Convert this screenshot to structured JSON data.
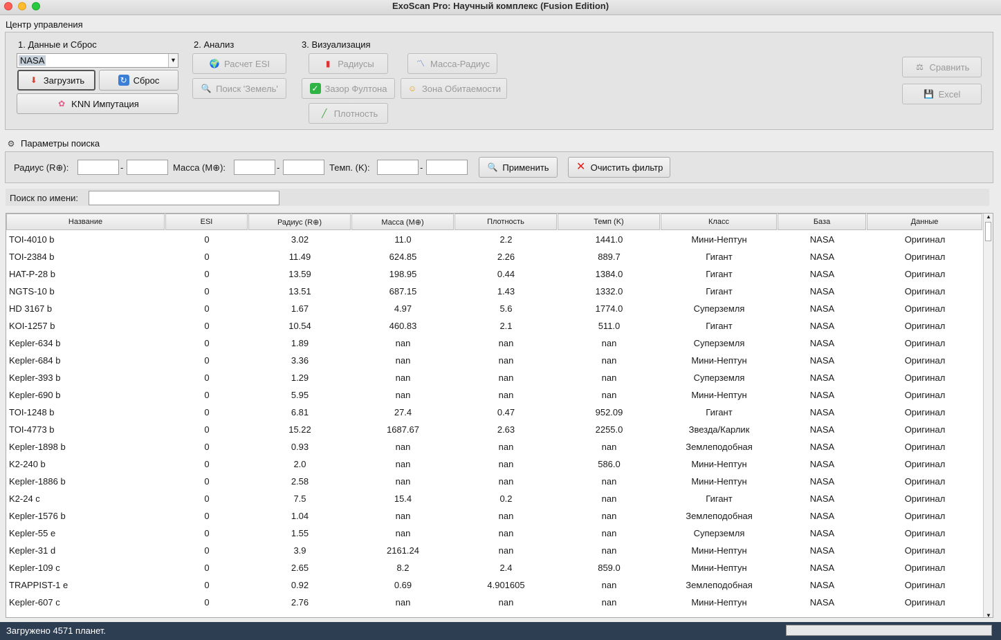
{
  "window": {
    "title": "ExoScan Pro: Научный комплекс (Fusion Edition)"
  },
  "control_center": {
    "title": "Центр управления",
    "data_reset": {
      "heading": "1. Данные и Сброс",
      "source_value": "NASA",
      "load_label": "Загрузить",
      "reset_label": "Сброс",
      "knn_label": "KNN Импутация"
    },
    "analysis": {
      "heading": "2. Анализ",
      "esi_label": "Расчет ESI",
      "earth_search_label": "Поиск 'Земель'"
    },
    "visualization": {
      "heading": "3. Визуализация",
      "radii_label": "Радиусы",
      "mass_radius_label": "Масса-Радиус",
      "fulton_gap_label": "Зазор Фултона",
      "habitable_zone_label": "Зона Обитаемости",
      "density_label": "Плотность"
    },
    "compare_label": "Сравнить",
    "excel_label": "Excel"
  },
  "search_params": {
    "title": "Параметры поиска",
    "radius_label": "Радиус (R⊕):",
    "mass_label": "Масса (M⊕):",
    "temp_label": "Темп. (K):",
    "dash": "-",
    "apply_label": "Применить",
    "clear_label": "Очистить фильтр"
  },
  "name_search": {
    "label": "Поиск по имени:",
    "value": ""
  },
  "table": {
    "columns": [
      "Название",
      "ESI",
      "Радиус (R⊕)",
      "Масса (M⊕)",
      "Плотность",
      "Темп (K)",
      "Класс",
      "База",
      "Данные"
    ],
    "rows": [
      [
        "TOI-4010 b",
        "0",
        "3.02",
        "11.0",
        "2.2",
        "1441.0",
        "Мини-Нептун",
        "NASA",
        "Оригинал"
      ],
      [
        "TOI-2384 b",
        "0",
        "11.49",
        "624.85",
        "2.26",
        "889.7",
        "Гигант",
        "NASA",
        "Оригинал"
      ],
      [
        "HAT-P-28 b",
        "0",
        "13.59",
        "198.95",
        "0.44",
        "1384.0",
        "Гигант",
        "NASA",
        "Оригинал"
      ],
      [
        "NGTS-10 b",
        "0",
        "13.51",
        "687.15",
        "1.43",
        "1332.0",
        "Гигант",
        "NASA",
        "Оригинал"
      ],
      [
        "HD 3167 b",
        "0",
        "1.67",
        "4.97",
        "5.6",
        "1774.0",
        "Суперземля",
        "NASA",
        "Оригинал"
      ],
      [
        "KOI-1257 b",
        "0",
        "10.54",
        "460.83",
        "2.1",
        "511.0",
        "Гигант",
        "NASA",
        "Оригинал"
      ],
      [
        "Kepler-634 b",
        "0",
        "1.89",
        "nan",
        "nan",
        "nan",
        "Суперземля",
        "NASA",
        "Оригинал"
      ],
      [
        "Kepler-684 b",
        "0",
        "3.36",
        "nan",
        "nan",
        "nan",
        "Мини-Нептун",
        "NASA",
        "Оригинал"
      ],
      [
        "Kepler-393 b",
        "0",
        "1.29",
        "nan",
        "nan",
        "nan",
        "Суперземля",
        "NASA",
        "Оригинал"
      ],
      [
        "Kepler-690 b",
        "0",
        "5.95",
        "nan",
        "nan",
        "nan",
        "Мини-Нептун",
        "NASA",
        "Оригинал"
      ],
      [
        "TOI-1248 b",
        "0",
        "6.81",
        "27.4",
        "0.47",
        "952.09",
        "Гигант",
        "NASA",
        "Оригинал"
      ],
      [
        "TOI-4773 b",
        "0",
        "15.22",
        "1687.67",
        "2.63",
        "2255.0",
        "Звезда/Карлик",
        "NASA",
        "Оригинал"
      ],
      [
        "Kepler-1898 b",
        "0",
        "0.93",
        "nan",
        "nan",
        "nan",
        "Землеподобная",
        "NASA",
        "Оригинал"
      ],
      [
        "K2-240 b",
        "0",
        "2.0",
        "nan",
        "nan",
        "586.0",
        "Мини-Нептун",
        "NASA",
        "Оригинал"
      ],
      [
        "Kepler-1886 b",
        "0",
        "2.58",
        "nan",
        "nan",
        "nan",
        "Мини-Нептун",
        "NASA",
        "Оригинал"
      ],
      [
        "K2-24 c",
        "0",
        "7.5",
        "15.4",
        "0.2",
        "nan",
        "Гигант",
        "NASA",
        "Оригинал"
      ],
      [
        "Kepler-1576 b",
        "0",
        "1.04",
        "nan",
        "nan",
        "nan",
        "Землеподобная",
        "NASA",
        "Оригинал"
      ],
      [
        "Kepler-55 e",
        "0",
        "1.55",
        "nan",
        "nan",
        "nan",
        "Суперземля",
        "NASA",
        "Оригинал"
      ],
      [
        "Kepler-31 d",
        "0",
        "3.9",
        "2161.24",
        "nan",
        "nan",
        "Мини-Нептун",
        "NASA",
        "Оригинал"
      ],
      [
        "Kepler-109 c",
        "0",
        "2.65",
        "8.2",
        "2.4",
        "859.0",
        "Мини-Нептун",
        "NASA",
        "Оригинал"
      ],
      [
        "TRAPPIST-1 e",
        "0",
        "0.92",
        "0.69",
        "4.901605",
        "nan",
        "Землеподобная",
        "NASA",
        "Оригинал"
      ],
      [
        "Kepler-607 c",
        "0",
        "2.76",
        "nan",
        "nan",
        "nan",
        "Мини-Нептун",
        "NASA",
        "Оригинал"
      ]
    ]
  },
  "status": {
    "text": "Загружено 4571 планет."
  },
  "colors": {
    "status_bar": "#2d3d52",
    "clear_icon": "#e0201b",
    "check_icon": "#2fb344"
  }
}
